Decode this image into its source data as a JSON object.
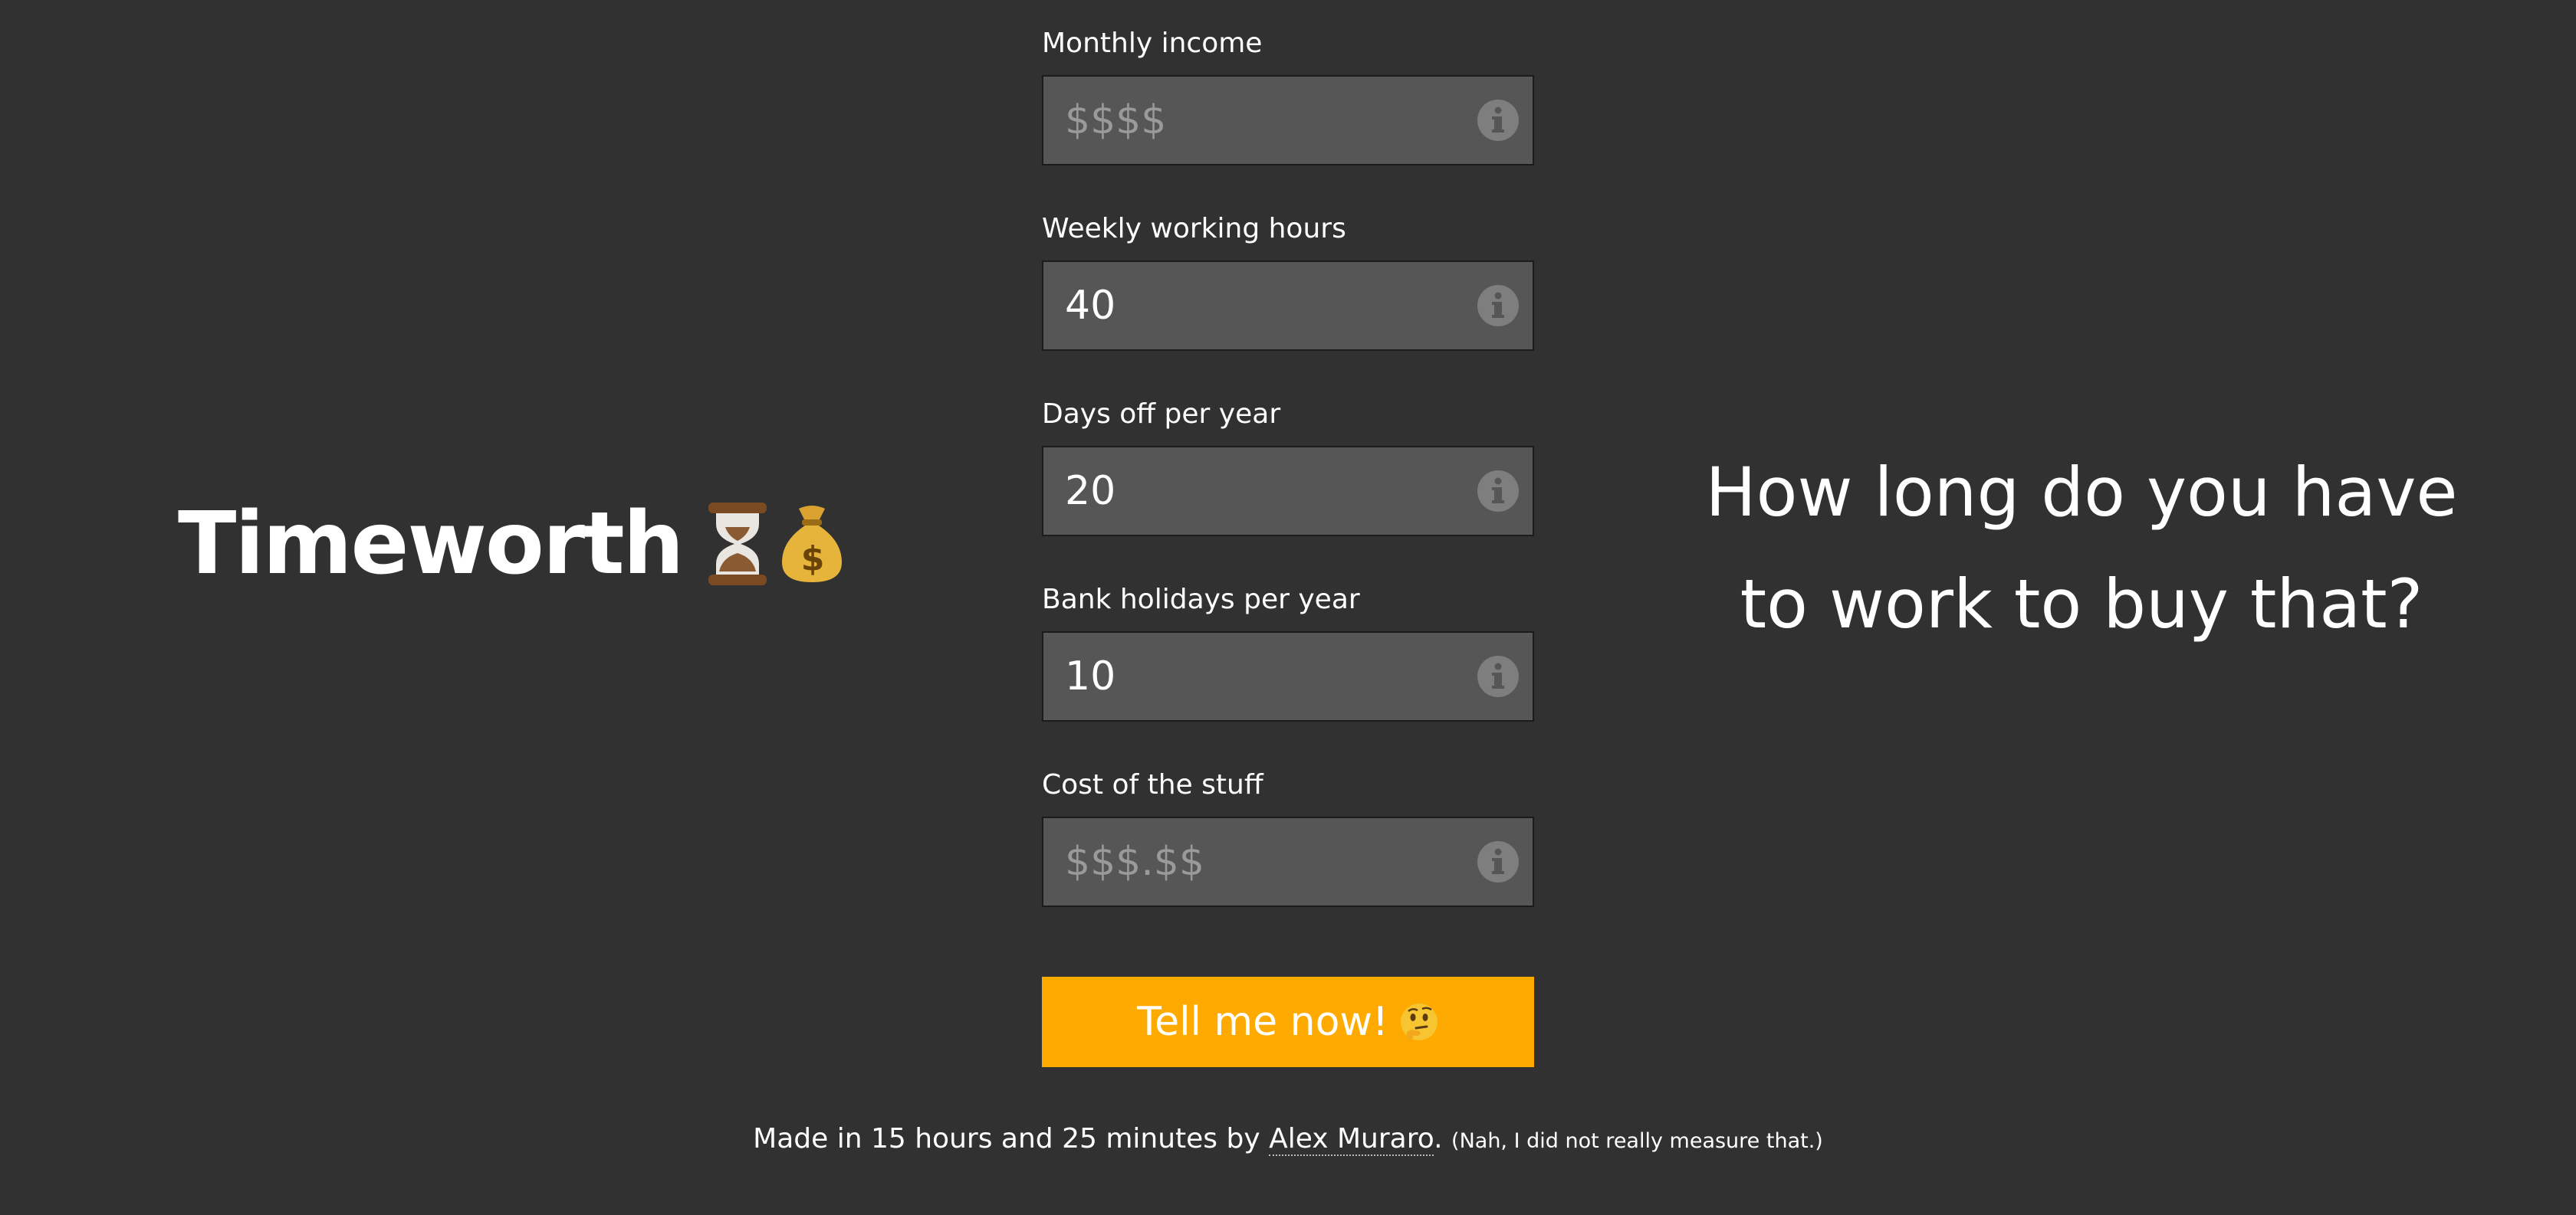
{
  "brand": {
    "title": "Timeworth"
  },
  "form": {
    "fields": [
      {
        "label": "Monthly income",
        "value": "",
        "placeholder": "$$$$"
      },
      {
        "label": "Weekly working hours",
        "value": "40",
        "placeholder": ""
      },
      {
        "label": "Days off per year",
        "value": "20",
        "placeholder": ""
      },
      {
        "label": "Bank holidays per year",
        "value": "10",
        "placeholder": ""
      },
      {
        "label": "Cost of the stuff",
        "value": "",
        "placeholder": "$$$.$$"
      }
    ],
    "submit_label": "Tell me now!"
  },
  "tagline": {
    "line1": "How long do you have",
    "line2": "to work to buy that?"
  },
  "footer": {
    "prefix": "Made in 15 hours and 25 minutes by",
    "author": "Alex Muraro",
    "suffix": ".",
    "note": "(Nah, I did not really measure that.)"
  },
  "icons": {
    "brand": [
      "hourglass-icon",
      "money-bag-icon"
    ],
    "field": "info-icon",
    "submit": "thinking-face-icon"
  },
  "colors": {
    "background": "#313131",
    "input_bg": "#565656",
    "accent": "#ffaa00",
    "text": "#ffffff",
    "placeholder": "#9a9a9a"
  }
}
